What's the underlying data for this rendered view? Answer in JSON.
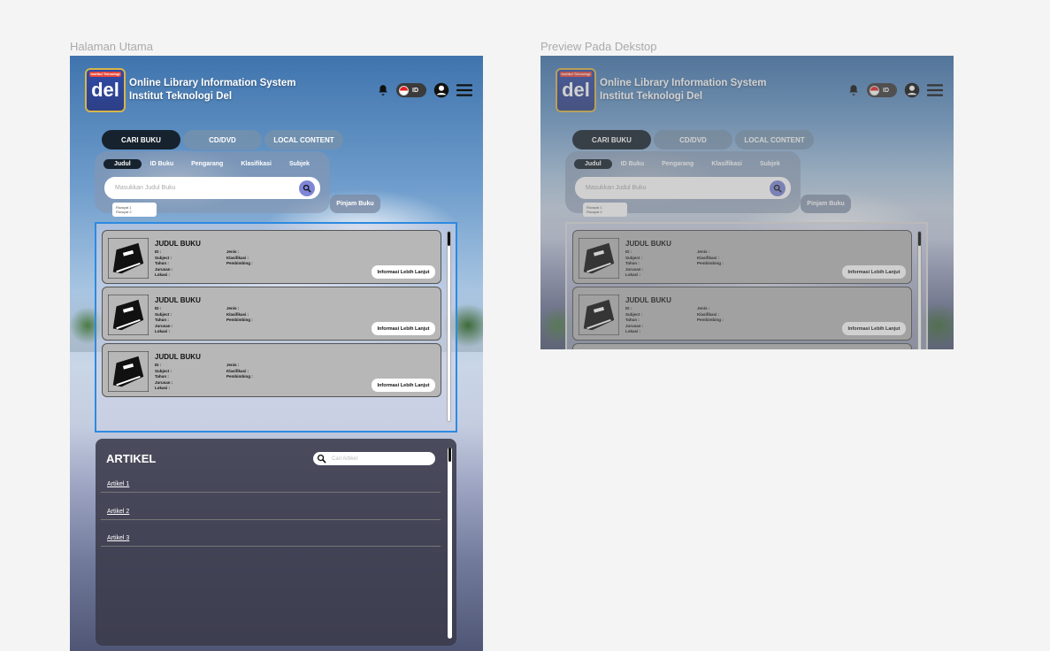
{
  "frames": {
    "main_label": "Halaman Utama",
    "preview_label": "Preview Pada Dekstop"
  },
  "header": {
    "logo_text": "del",
    "logo_banner": "Institut Teknologi",
    "title_line1": "Online Library Information System",
    "title_line2": "Institut Teknologi Del",
    "language": "ID"
  },
  "tabs": [
    "CARI BUKU",
    "CD/DVD",
    "LOCAL CONTENT"
  ],
  "search": {
    "filters": [
      "Judul",
      "ID Buku",
      "Pengarang",
      "Klasifikasi",
      "Subjek"
    ],
    "placeholder": "Masukkan Judul Buku",
    "history": [
      "Riwayat 1",
      "Riwayat 2"
    ],
    "borrow_label": "Pinjam Buku"
  },
  "books": [
    {
      "title": "JUDUL BUKU",
      "left_fields": [
        "ID :",
        "Subject :",
        "Tahun :",
        "Jurusan :",
        "Lokasi :"
      ],
      "right_fields": [
        "Jenis :",
        "Klasifikasi :",
        "Pembimbing :"
      ],
      "button": "Informasi Lebih Lanjut"
    },
    {
      "title": "JUDUL BUKU",
      "left_fields": [
        "ID :",
        "Subject :",
        "Tahun :",
        "Jurusan :",
        "Lokasi :"
      ],
      "right_fields": [
        "Jenis :",
        "Klasifikasi :",
        "Pembimbing :"
      ],
      "button": "Informasi Lebih Lanjut"
    },
    {
      "title": "JUDUL BUKU",
      "left_fields": [
        "ID :",
        "Subject :",
        "Tahun :",
        "Jurusan :",
        "Lokasi :"
      ],
      "right_fields": [
        "Jenis :",
        "Klasifikasi :",
        "Pembimbing :"
      ],
      "button": "Informasi Lebih Lanjut"
    }
  ],
  "artikel": {
    "title": "ARTIKEL",
    "search_placeholder": "Cari Artikel",
    "items": [
      "Artikel 1",
      "Artikel 2",
      "Artikel 3"
    ]
  },
  "colors": {
    "active_tab": "#16222d",
    "selection_border": "#2d8ae0",
    "book_card": "#b7b7b7",
    "artikel_panel": "#3a3a4a",
    "search_button": "#7f86d6"
  }
}
